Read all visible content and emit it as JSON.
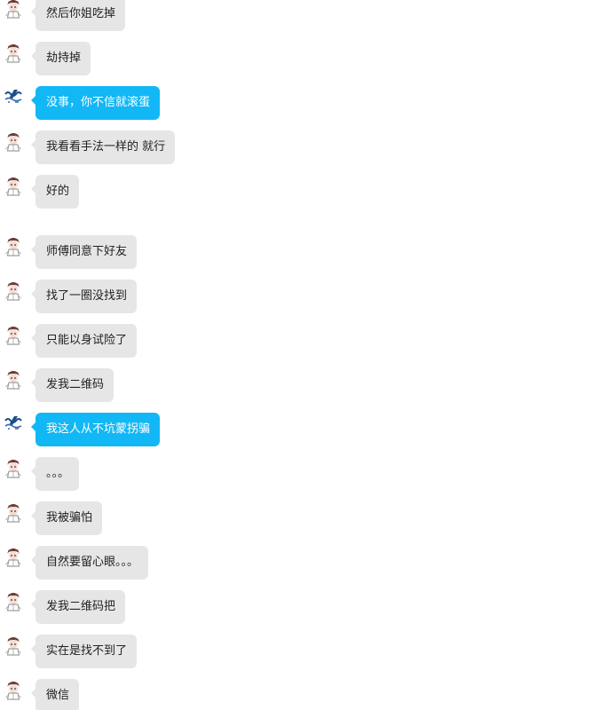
{
  "colors": {
    "other_bubble": "#e6e6e6",
    "self_bubble": "#12b7f5",
    "other_text": "#222222",
    "self_text": "#ffffff"
  },
  "messages": [
    {
      "sender": "other",
      "avatar_icon": "chibi-character-avatar-icon",
      "text": "然后你姐吃掉"
    },
    {
      "sender": "other",
      "avatar_icon": "chibi-character-avatar-icon",
      "text": "劫持掉"
    },
    {
      "sender": "self",
      "avatar_icon": "wave-logo-avatar-icon",
      "text": "没事，你不信就滚蛋"
    },
    {
      "sender": "other",
      "avatar_icon": "chibi-character-avatar-icon",
      "text": "我看看手法一样的 就行"
    },
    {
      "sender": "other",
      "avatar_icon": "chibi-character-avatar-icon",
      "text": "好的"
    },
    {
      "sender": "other",
      "avatar_icon": "chibi-character-avatar-icon",
      "text": "师傅同意下好友"
    },
    {
      "sender": "other",
      "avatar_icon": "chibi-character-avatar-icon",
      "text": "找了一圈没找到"
    },
    {
      "sender": "other",
      "avatar_icon": "chibi-character-avatar-icon",
      "text": "只能以身试险了"
    },
    {
      "sender": "other",
      "avatar_icon": "chibi-character-avatar-icon",
      "text": "发我二维码"
    },
    {
      "sender": "self",
      "avatar_icon": "wave-logo-avatar-icon",
      "text": "我这人从不坑蒙拐骗"
    },
    {
      "sender": "other",
      "avatar_icon": "chibi-character-avatar-icon",
      "text": "。。。"
    },
    {
      "sender": "other",
      "avatar_icon": "chibi-character-avatar-icon",
      "text": "我被骗怕"
    },
    {
      "sender": "other",
      "avatar_icon": "chibi-character-avatar-icon",
      "text": "自然要留心眼。。。"
    },
    {
      "sender": "other",
      "avatar_icon": "chibi-character-avatar-icon",
      "text": "发我二维码把"
    },
    {
      "sender": "other",
      "avatar_icon": "chibi-character-avatar-icon",
      "text": "实在是找不到了"
    },
    {
      "sender": "other",
      "avatar_icon": "chibi-character-avatar-icon",
      "text": "微信"
    }
  ]
}
